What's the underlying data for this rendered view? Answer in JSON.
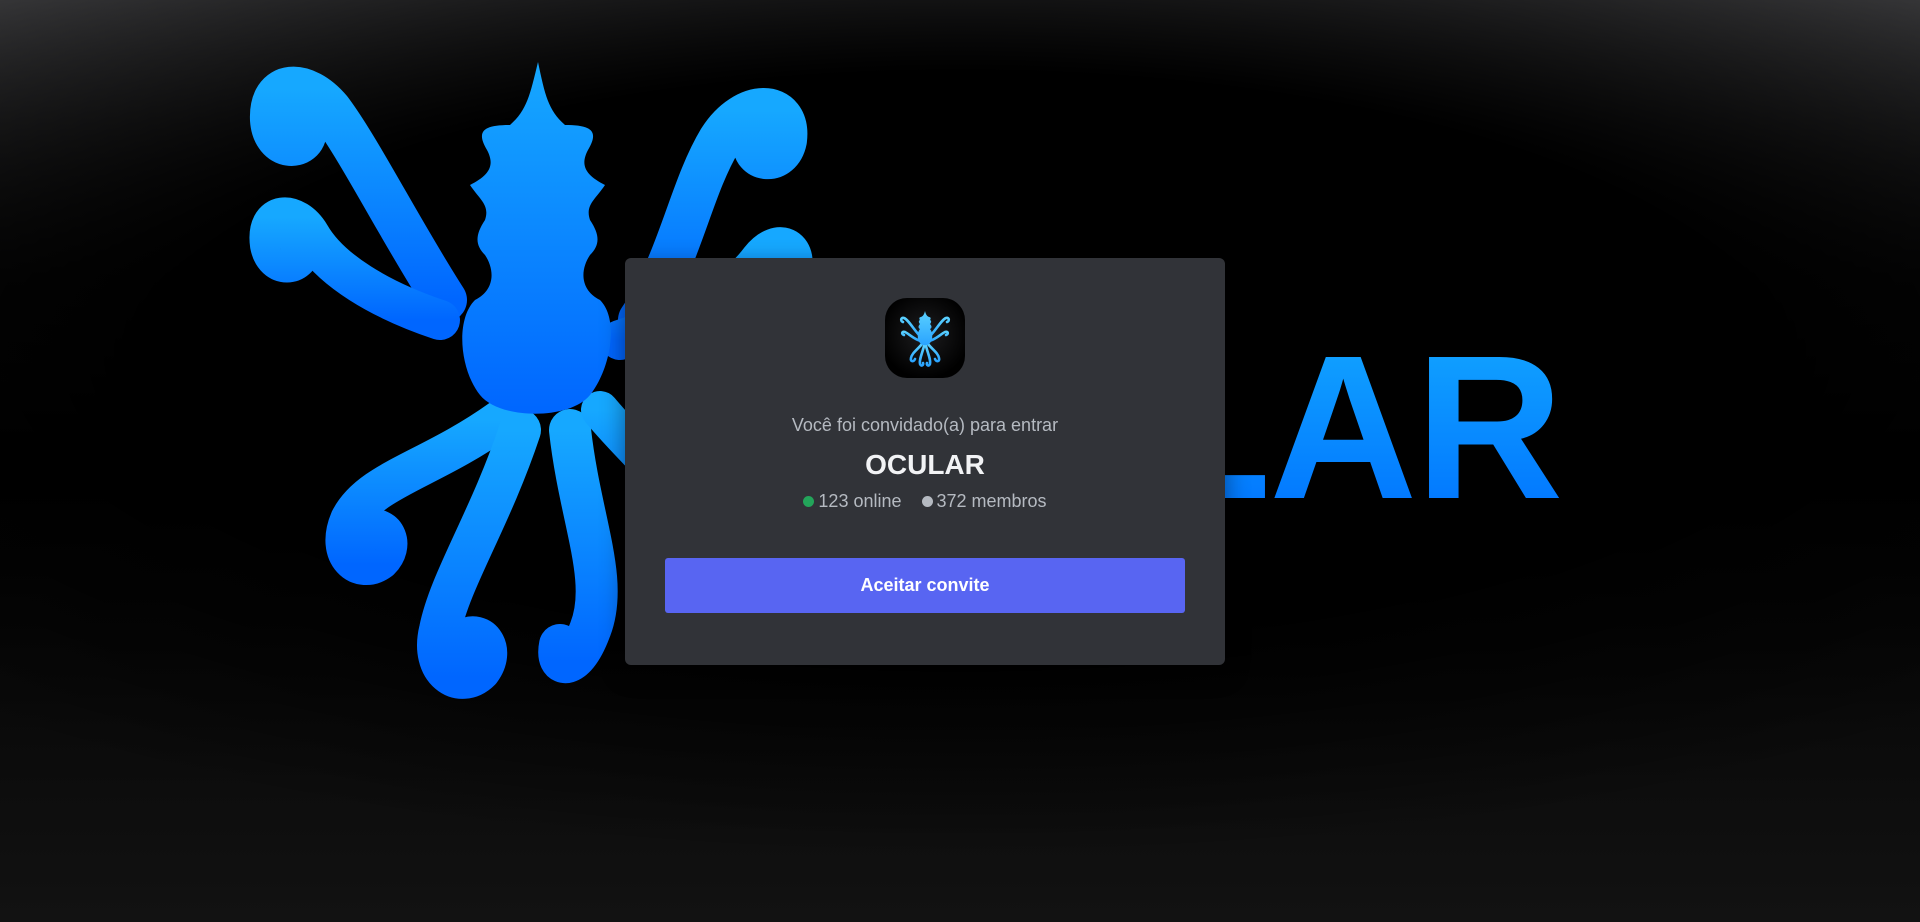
{
  "background": {
    "wordmark": "ULAR",
    "brand_gradient": [
      "#12a6ff",
      "#0072ff"
    ],
    "logo_icon": "octopus-logo-icon"
  },
  "invite": {
    "server_icon": "octopus-server-icon",
    "heading": "Você foi convidado(a) para entrar",
    "server_name": "OCULAR",
    "online_count": "123 online",
    "member_count": "372 membros",
    "accept_label": "Aceitar convite"
  },
  "colors": {
    "modal_bg": "#313338",
    "accept_button": "#5865f2",
    "online_dot": "#23a55a",
    "members_dot": "#b5bac1"
  }
}
